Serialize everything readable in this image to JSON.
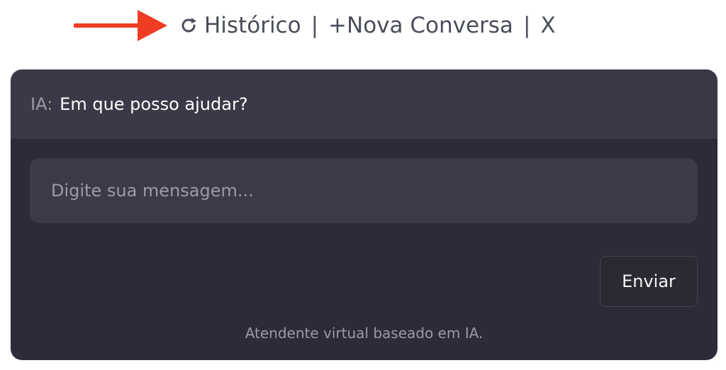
{
  "header": {
    "history_label": "Histórico",
    "separator": "|",
    "new_chat_label": "+Nova Conversa",
    "close_label": "X"
  },
  "chat": {
    "speaker": "IA:",
    "message": "Em que posso ajudar?"
  },
  "composer": {
    "placeholder": "Digite sua mensagem...",
    "value": "",
    "send_label": "Enviar"
  },
  "footer": {
    "note": "Atendente virtual baseado em IA."
  },
  "icons": {
    "annotation_arrow": "arrow-right-icon",
    "history": "refresh-icon"
  },
  "colors": {
    "annotation_arrow": "#ee3d23",
    "card_bg": "#2c2c38",
    "card_top_bg": "#3a3947",
    "input_bg": "#3a3a48",
    "text_primary": "#ffffff",
    "text_muted": "#9a99a8"
  }
}
